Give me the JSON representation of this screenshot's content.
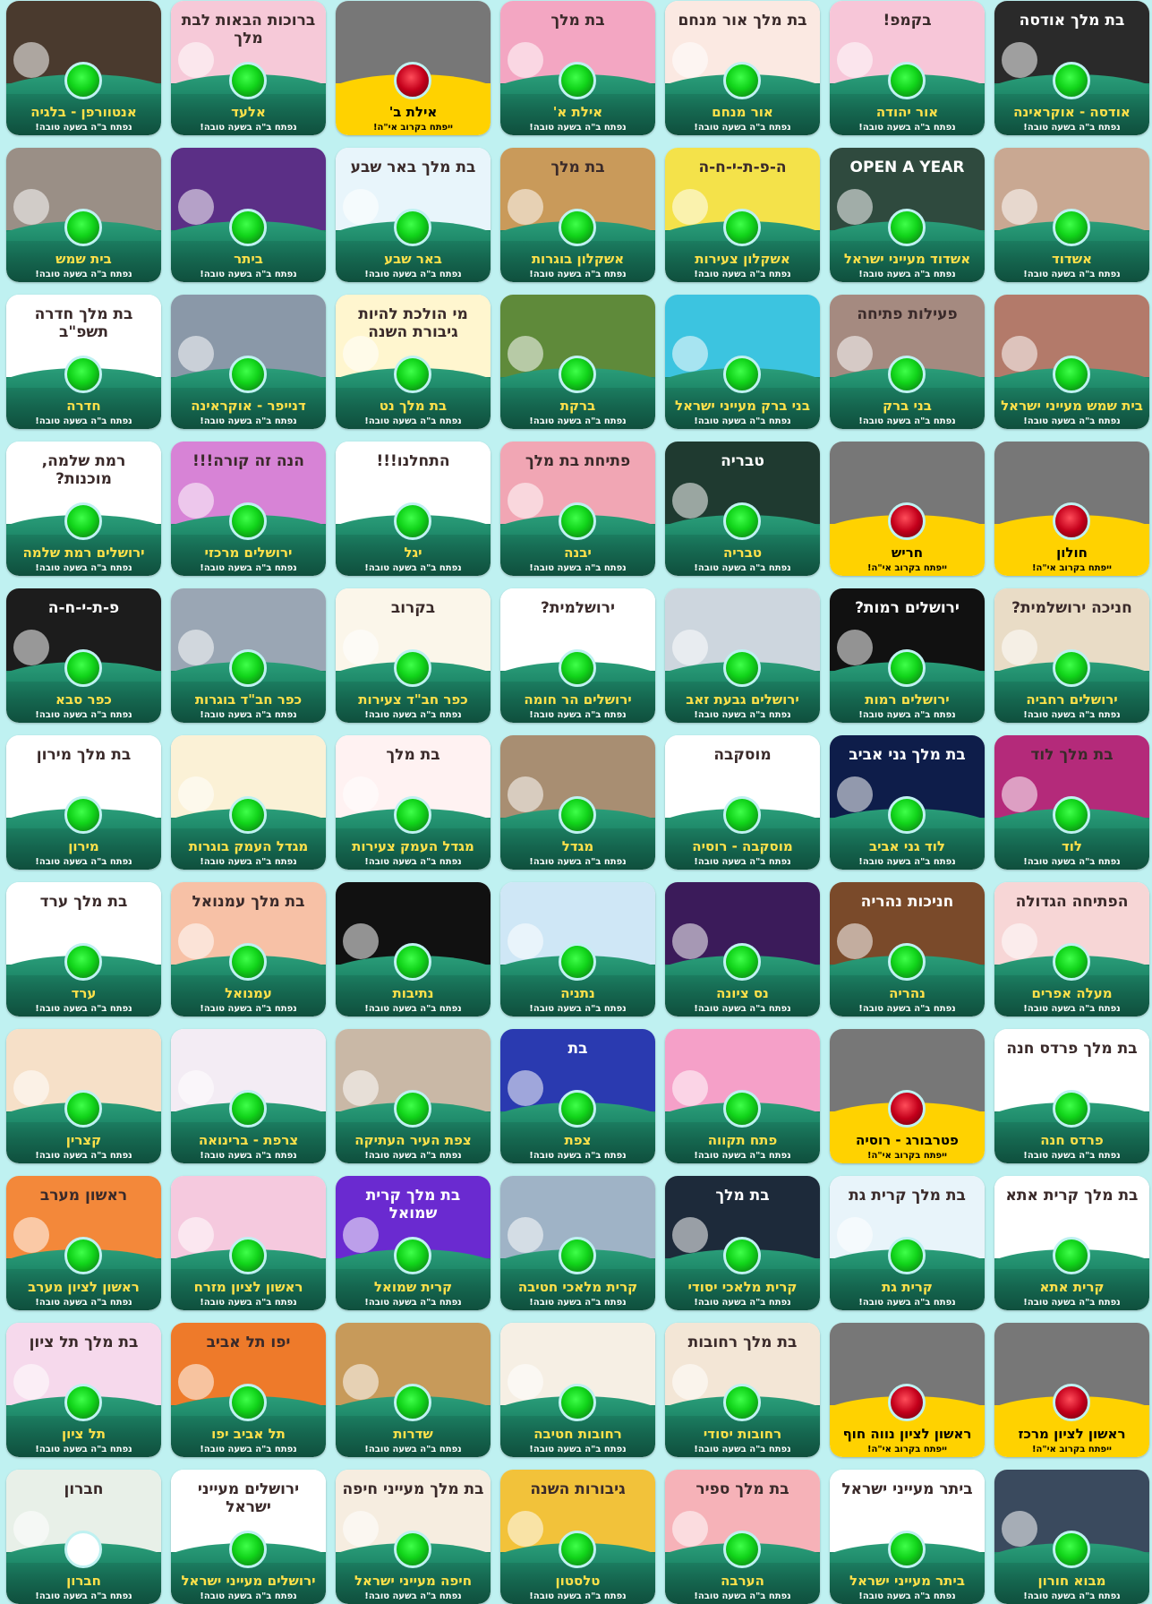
{
  "status_labels": {
    "open": "נפתח ב\"ה בשעה טובה!",
    "soon": "ייפתח בקרוב אי\"ה!"
  },
  "colors": {
    "page_background": "#bff1f1",
    "band_green": "#1a7a5e",
    "name_yellow": "#ffe14a",
    "soon_band_yellow": "#ffd200",
    "indicator_green": "#11d41a",
    "indicator_red": "#c4001b"
  },
  "cards": [
    {
      "name": "אודסה - אוקראינה",
      "status": "open",
      "thumb_color": "#2a2a2a",
      "thumb_text": "בת מלך אודסה"
    },
    {
      "name": "אור יהודה",
      "status": "open",
      "thumb_color": "#f7c6d8",
      "thumb_text": "בקמפ!"
    },
    {
      "name": "אור מנחם",
      "status": "open",
      "thumb_color": "#fbe9e2",
      "thumb_text": "בת מלך אור מנחם"
    },
    {
      "name": "אילת א'",
      "status": "open",
      "thumb_color": "#f3a6c2",
      "thumb_text": "בת מלך"
    },
    {
      "name": "אילת ב'",
      "status": "soon",
      "thumb_color": "",
      "thumb_text": ""
    },
    {
      "name": "אלעד",
      "status": "open",
      "thumb_color": "#f6c9d8",
      "thumb_text": "ברוכות הבאות לבת מלך"
    },
    {
      "name": "אנטוורפן - בלגיה",
      "status": "open",
      "thumb_color": "#4a3a2e",
      "thumb_text": ""
    },
    {
      "name": "אשדוד",
      "status": "open",
      "thumb_color": "#c9a892",
      "thumb_text": ""
    },
    {
      "name": "אשדוד מעייני ישראל",
      "status": "open",
      "thumb_color": "#2f4a3e",
      "thumb_text": "OPEN A YEAR"
    },
    {
      "name": "אשקלון צעירות",
      "status": "open",
      "thumb_color": "#f4e24a",
      "thumb_text": "ה-פ-ת-י-ח-ה"
    },
    {
      "name": "אשקלון בוגרות",
      "status": "open",
      "thumb_color": "#c99a5a",
      "thumb_text": "בת מלך"
    },
    {
      "name": "באר שבע",
      "status": "open",
      "thumb_color": "#e8f5fb",
      "thumb_text": "בת מלך באר שבע"
    },
    {
      "name": "ביתר",
      "status": "open",
      "thumb_color": "#5b2f86",
      "thumb_text": ""
    },
    {
      "name": "בית שמש",
      "status": "open",
      "thumb_color": "#9a8f86",
      "thumb_text": ""
    },
    {
      "name": "בית שמש מעייני ישראל",
      "status": "open",
      "thumb_color": "#b37a6a",
      "thumb_text": ""
    },
    {
      "name": "בני ברק",
      "status": "open",
      "thumb_color": "#a58a80",
      "thumb_text": "פעילות פתיחה"
    },
    {
      "name": "בני ברק מעייני ישראל",
      "status": "open",
      "thumb_color": "#3cc4e0",
      "thumb_text": ""
    },
    {
      "name": "ברקת",
      "status": "open",
      "thumb_color": "#5f8a3a",
      "thumb_text": ""
    },
    {
      "name": "בת מלך נט",
      "status": "open",
      "thumb_color": "#fff6cf",
      "thumb_text": "מי הולכת להיות גיבורת השנה"
    },
    {
      "name": "דנייפר - אוקראינה",
      "status": "open",
      "thumb_color": "#8a98a8",
      "thumb_text": ""
    },
    {
      "name": "חדרה",
      "status": "open",
      "thumb_color": "#ffffff",
      "thumb_text": "בת מלך חדרה תשפ\"ב"
    },
    {
      "name": "חולון",
      "status": "soon",
      "thumb_color": "",
      "thumb_text": ""
    },
    {
      "name": "חריש",
      "status": "soon",
      "thumb_color": "",
      "thumb_text": ""
    },
    {
      "name": "טבריה",
      "status": "open",
      "thumb_color": "#1f3a30",
      "thumb_text": "טבריה"
    },
    {
      "name": "יבנה",
      "status": "open",
      "thumb_color": "#f1a6b4",
      "thumb_text": "פתיחת בת מלך"
    },
    {
      "name": "יגל",
      "status": "open",
      "thumb_color": "#ffffff",
      "thumb_text": "התחלנו!!!"
    },
    {
      "name": "ירושלים מרכזי",
      "status": "open",
      "thumb_color": "#d783d6",
      "thumb_text": "הנה זה קורה!!!"
    },
    {
      "name": "ירושלים רמת שלמה",
      "status": "open",
      "thumb_color": "#ffffff",
      "thumb_text": "רמת שלמה, מוכנות?"
    },
    {
      "name": "ירושלים רחביה",
      "status": "open",
      "thumb_color": "#e9dcc6",
      "thumb_text": "חניכה ירושלמית?"
    },
    {
      "name": "ירושלים רמות",
      "status": "open",
      "thumb_color": "#111111",
      "thumb_text": "ירושלים רמות?"
    },
    {
      "name": "ירושלים גבעת זאב",
      "status": "open",
      "thumb_color": "#cdd6de",
      "thumb_text": ""
    },
    {
      "name": "ירושלים הר חומה",
      "status": "open",
      "thumb_color": "#ffffff",
      "thumb_text": "ירושלמית?"
    },
    {
      "name": "כפר חב\"ד צעירות",
      "status": "open",
      "thumb_color": "#fbf6ea",
      "thumb_text": "בקרוב"
    },
    {
      "name": "כפר חב\"ד בוגרות",
      "status": "open",
      "thumb_color": "#9aa6b4",
      "thumb_text": ""
    },
    {
      "name": "כפר סבא",
      "status": "open",
      "thumb_color": "#1c1c1c",
      "thumb_text": "פ-ת-י-ח-ה"
    },
    {
      "name": "לוד",
      "status": "open",
      "thumb_color": "#b42a7a",
      "thumb_text": "בת מלך לוד"
    },
    {
      "name": "לוד גני אביב",
      "status": "open",
      "thumb_color": "#0e1d4a",
      "thumb_text": "בת מלך גני אביב"
    },
    {
      "name": "מוסקבה - רוסיה",
      "status": "open",
      "thumb_color": "#ffffff",
      "thumb_text": "מוסקבה"
    },
    {
      "name": "מגדל",
      "status": "open",
      "thumb_color": "#a88e72",
      "thumb_text": ""
    },
    {
      "name": "מגדל העמק צעירות",
      "status": "open",
      "thumb_color": "#fff2f2",
      "thumb_text": "בת מלך"
    },
    {
      "name": "מגדל העמק בוגרות",
      "status": "open",
      "thumb_color": "#fbf1d6",
      "thumb_text": ""
    },
    {
      "name": "מירון",
      "status": "open",
      "thumb_color": "#ffffff",
      "thumb_text": "בת מלך מירון"
    },
    {
      "name": "מעלה אפרים",
      "status": "open",
      "thumb_color": "#f7d6d6",
      "thumb_text": "הפתיחה הגדולה"
    },
    {
      "name": "נהריה",
      "status": "open",
      "thumb_color": "#7a4a2a",
      "thumb_text": "חניכות נהריה"
    },
    {
      "name": "נס ציונה",
      "status": "open",
      "thumb_color": "#3b1b5a",
      "thumb_text": ""
    },
    {
      "name": "נתניה",
      "status": "open",
      "thumb_color": "#cfe7f6",
      "thumb_text": ""
    },
    {
      "name": "נתיבות",
      "status": "open",
      "thumb_color": "#111111",
      "thumb_text": ""
    },
    {
      "name": "עמנואל",
      "status": "open",
      "thumb_color": "#f7c1a6",
      "thumb_text": "בת מלך עמנואל"
    },
    {
      "name": "ערד",
      "status": "open",
      "thumb_color": "#ffffff",
      "thumb_text": "בת מלך ערד"
    },
    {
      "name": "פרדס חנה",
      "status": "open",
      "thumb_color": "#ffffff",
      "thumb_text": "בת מלך פרדס חנה"
    },
    {
      "name": "פטרבורג - רוסיה",
      "status": "soon",
      "thumb_color": "",
      "thumb_text": ""
    },
    {
      "name": "פתח תקווה",
      "status": "open",
      "thumb_color": "#f5a0c8",
      "thumb_text": ""
    },
    {
      "name": "צפת",
      "status": "open",
      "thumb_color": "#2a3ab0",
      "thumb_text": "בת"
    },
    {
      "name": "צפת העיר העתיקה",
      "status": "open",
      "thumb_color": "#c9b8a6",
      "thumb_text": ""
    },
    {
      "name": "צרפת - ברינואה",
      "status": "open",
      "thumb_color": "#f3ecf4",
      "thumb_text": ""
    },
    {
      "name": "קצרין",
      "status": "open",
      "thumb_color": "#f6e0c8",
      "thumb_text": ""
    },
    {
      "name": "קרית אתא",
      "status": "open",
      "thumb_color": "#ffffff",
      "thumb_text": "בת מלך קרית אתא"
    },
    {
      "name": "קרית גת",
      "status": "open",
      "thumb_color": "#e8f4fa",
      "thumb_text": "בת מלך קרית גת"
    },
    {
      "name": "קרית מלאכי יסודי",
      "status": "open",
      "thumb_color": "#1d2a3a",
      "thumb_text": "בת מלך"
    },
    {
      "name": "קרית מלאכי חטיבה",
      "status": "open",
      "thumb_color": "#9fb3c6",
      "thumb_text": ""
    },
    {
      "name": "קרית שמואל",
      "status": "open",
      "thumb_color": "#6a2ad0",
      "thumb_text": "בת מלך קרית שמואל"
    },
    {
      "name": "ראשון לציון מזרח",
      "status": "open",
      "thumb_color": "#f5c9de",
      "thumb_text": ""
    },
    {
      "name": "ראשון לציון מערב",
      "status": "open",
      "thumb_color": "#f3883a",
      "thumb_text": "ראשון מערב"
    },
    {
      "name": "ראשון לציון מרכז",
      "status": "soon",
      "thumb_color": "",
      "thumb_text": ""
    },
    {
      "name": "ראשון לציון נווה חוף",
      "status": "soon",
      "thumb_color": "",
      "thumb_text": ""
    },
    {
      "name": "רחובות יסודי",
      "status": "open",
      "thumb_color": "#f3e6d6",
      "thumb_text": "בת מלך רחובות"
    },
    {
      "name": "רחובות חטיבה",
      "status": "open",
      "thumb_color": "#f6efe4",
      "thumb_text": ""
    },
    {
      "name": "שדרות",
      "status": "open",
      "thumb_color": "#c79a5a",
      "thumb_text": ""
    },
    {
      "name": "תל אביב יפו",
      "status": "open",
      "thumb_color": "#ee7a2a",
      "thumb_text": "יפו תל אביב"
    },
    {
      "name": "תל ציון",
      "status": "open",
      "thumb_color": "#f6d9ec",
      "thumb_text": "בת מלך תל ציון"
    },
    {
      "name": "מבוא חורון",
      "status": "open",
      "thumb_color": "#3a4a5e",
      "thumb_text": ""
    },
    {
      "name": "ביתר מעייני ישראל",
      "status": "open",
      "thumb_color": "#ffffff",
      "thumb_text": "ביתר מעייני ישראל"
    },
    {
      "name": "הערבה",
      "status": "open",
      "thumb_color": "#f6b2b8",
      "thumb_text": "בת מלך ספיר"
    },
    {
      "name": "טלסטון",
      "status": "open",
      "thumb_color": "#f2c23a",
      "thumb_text": "גיבורות השנה"
    },
    {
      "name": "חיפה מעייני ישראל",
      "status": "open",
      "thumb_color": "#f6ede0",
      "thumb_text": "בת מלך מעייני חיפה"
    },
    {
      "name": "ירושלים מעייני ישראל",
      "status": "open",
      "thumb_color": "#ffffff",
      "thumb_text": "ירושלים מעייני ישראל"
    },
    {
      "name": "חברון",
      "status": "open",
      "thumb_color": "#e8f0e8",
      "thumb_text": "חברון",
      "indicator": "white"
    }
  ]
}
